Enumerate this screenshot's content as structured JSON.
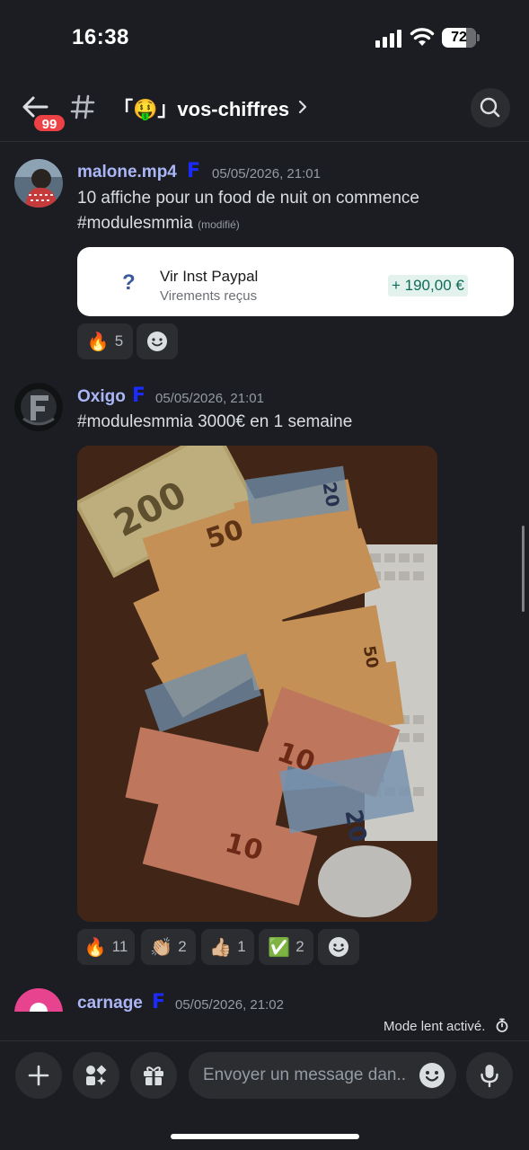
{
  "status_bar": {
    "time": "16:38",
    "battery": "72"
  },
  "header": {
    "back_badge": "99",
    "channel_emoji": "🤑",
    "channel_name": "「🤑」vos-chiffres"
  },
  "messages": [
    {
      "username": "malone.mp4",
      "role_icon": "F",
      "timestamp": "05/05/2026, 21:01",
      "text_line1": "10 affiche pour un food de nuit on commence",
      "text_line2": "#modulesmmia",
      "edited": "(modifié)",
      "card": {
        "icon": "?",
        "title": "Vir Inst Paypal",
        "subtitle": "Virements reçus",
        "amount": "+ 190,00 €"
      },
      "reactions": [
        {
          "emoji": "🔥",
          "count": "5"
        }
      ]
    },
    {
      "username": "Oxigo",
      "role_icon": "F",
      "timestamp": "05/05/2026, 21:01",
      "text": "#modulesmmia 3000€ en 1 semaine",
      "reactions": [
        {
          "emoji": "🔥",
          "count": "11"
        },
        {
          "emoji": "👏🏼",
          "count": "2"
        },
        {
          "emoji": "👍🏼",
          "count": "1"
        },
        {
          "emoji": "✅",
          "count": "2"
        }
      ]
    },
    {
      "username": "carnage",
      "role_icon": "F",
      "timestamp": "05/05/2026, 21:02"
    }
  ],
  "slow_mode": "Mode lent activé.",
  "composer": {
    "placeholder": "Envoyer un message dan.."
  },
  "colors": {
    "accent": "#aab6f5",
    "badge": "#ed4245",
    "background": "#1c1d22"
  }
}
